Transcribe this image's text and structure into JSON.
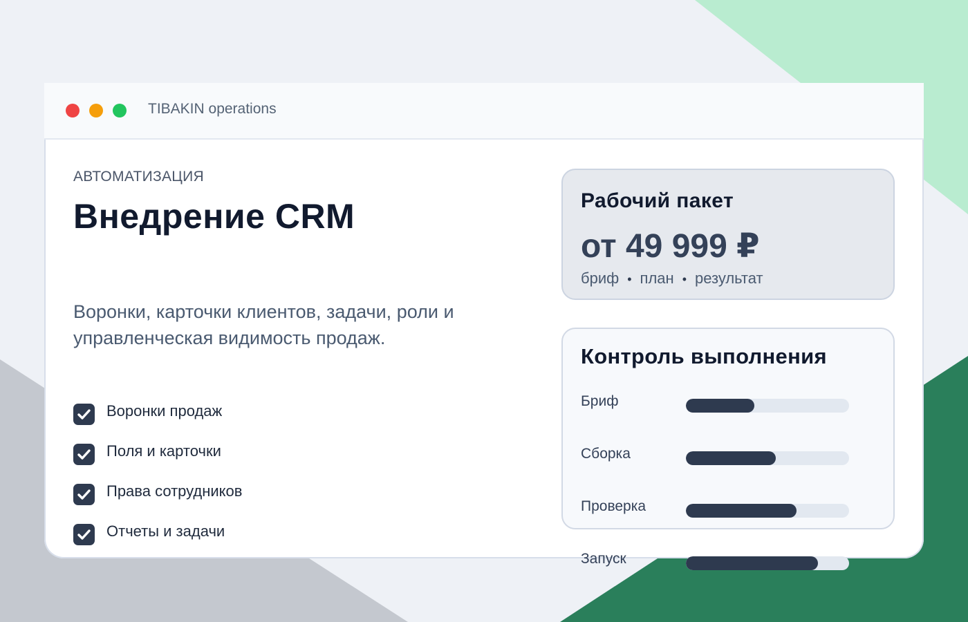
{
  "window": {
    "title": "TIBAKIN operations",
    "controls": [
      {
        "name": "close",
        "color": "#ef4444"
      },
      {
        "name": "minimize",
        "color": "#f59e0b"
      },
      {
        "name": "maximize",
        "color": "#22c55e"
      }
    ]
  },
  "main": {
    "eyebrow": "АВТОМАТИЗАЦИЯ",
    "title": "Внедрение CRM",
    "description": "Воронки, карточки клиентов, задачи, роли и управленческая видимость продаж.",
    "features": [
      {
        "label": "Воронки продаж",
        "checked": true
      },
      {
        "label": "Поля и карточки",
        "checked": true
      },
      {
        "label": "Права сотрудников",
        "checked": true
      },
      {
        "label": "Отчеты и задачи",
        "checked": true
      }
    ]
  },
  "price_card": {
    "heading": "Рабочий пакет",
    "price": "от 49 999 ₽",
    "steps": [
      "бриф",
      "план",
      "результат"
    ]
  },
  "progress_card": {
    "heading": "Контроль выполнения",
    "rows": [
      {
        "label": "Бриф",
        "progress": 0.42
      },
      {
        "label": "Сборка",
        "progress": 0.55
      },
      {
        "label": "Проверка",
        "progress": 0.68
      },
      {
        "label": "Запуск",
        "progress": 0.81
      }
    ]
  },
  "colors": {
    "accent_dark": "#2e3a4f",
    "bg_green_light": "#b9ecd0",
    "bg_green_dark": "#2a7f5b",
    "bg_gray": "#c4c8cf"
  }
}
